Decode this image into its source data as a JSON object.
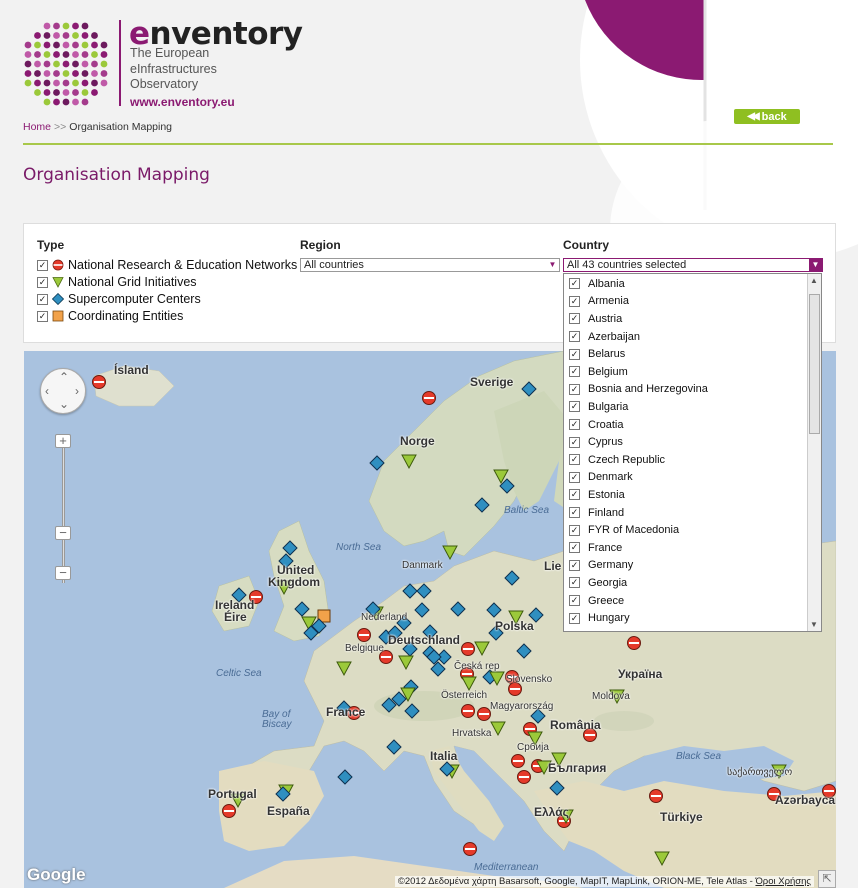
{
  "brand": {
    "name_prefix": "e",
    "name_rest": "nventory",
    "tagline_lines": [
      "The European",
      "eInfrastructures",
      "Observatory"
    ],
    "url": "www.enventory.eu"
  },
  "header": {
    "back_label": "back",
    "breadcrumb": {
      "home": "Home",
      "separator": ">>",
      "current": "Organisation Mapping"
    }
  },
  "page": {
    "title": "Organisation Mapping"
  },
  "filters": {
    "type_header": "Type",
    "region_header": "Region",
    "country_header": "Country",
    "types": [
      {
        "label": "National Research & Education Networks",
        "checked": true,
        "icon": "red-circle-icon"
      },
      {
        "label": "National Grid Initiatives",
        "checked": true,
        "icon": "green-triangle-icon"
      },
      {
        "label": "Supercomputer Centers",
        "checked": true,
        "icon": "blue-diamond-icon"
      },
      {
        "label": "Coordinating Entities",
        "checked": true,
        "icon": "orange-square-icon"
      }
    ],
    "region_value": "All countries",
    "country_value": "All 43 countries selected",
    "country_options": [
      "Albania",
      "Armenia",
      "Austria",
      "Azerbaijan",
      "Belarus",
      "Belgium",
      "Bosnia and Herzegovina",
      "Bulgaria",
      "Croatia",
      "Cyprus",
      "Czech Republic",
      "Denmark",
      "Estonia",
      "Finland",
      "FYR of Macedonia",
      "France",
      "Germany",
      "Georgia",
      "Greece",
      "Hungary"
    ]
  },
  "map": {
    "labels": {
      "island": "Ísland",
      "sverige": "Sverige",
      "norge": "Norge",
      "uk1": "United",
      "uk2": "Kingdom",
      "ireland1": "Ireland",
      "ireland2": "Éire",
      "danmark": "Danmark",
      "nederland": "Nederland",
      "belgique": "Belgique",
      "deutschland": "Deutschland",
      "polska": "Polska",
      "ceska": "Česká rep",
      "slovensko": "Slovensko",
      "osterreich": "Österreich",
      "magyar": "Magyarország",
      "ukraina": "Україна",
      "moldova": "Moldova",
      "france": "France",
      "hrvatska": "Hrvatska",
      "romania": "România",
      "srbija": "Србија",
      "italia": "Italia",
      "bulgaria": "България",
      "portugal": "Portugal",
      "espana": "España",
      "ellas": "Ελλάς",
      "turkiye": "Türkiye",
      "sakartvelo": "საქართველო",
      "azerbaijan": "Azərbaycan",
      "lie": "Lie"
    },
    "seas": {
      "north_sea": "North Sea",
      "baltic_sea": "Baltic Sea",
      "celtic_sea": "Celtic Sea",
      "bay1": "Bay of",
      "bay2": "Biscay",
      "black_sea": "Black Sea",
      "mediterranean": "Mediterranean"
    },
    "google": "Google",
    "attribution_text": "©2012 Δεδομένα χάρτη Basarsoft, Google, MapIT, MapLink, ORION-ME, Tele Atlas - ",
    "attribution_link": "Όροι Χρήσης",
    "colors": {
      "nren": "#e53a2a",
      "ngi": "#9bc93a",
      "hpc": "#2f8fc0",
      "ce": "#f2a24a"
    }
  }
}
